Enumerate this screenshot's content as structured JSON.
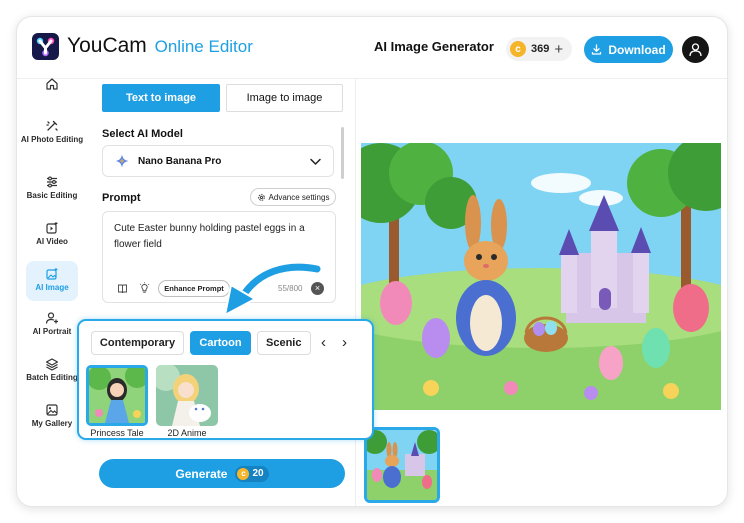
{
  "header": {
    "brand_name": "YouCam",
    "brand_suffix": "Online Editor",
    "page_title": "AI Image Generator",
    "coin_balance": "369",
    "add_symbol": "+",
    "download_label": "Download"
  },
  "sidebar": {
    "items": [
      {
        "label": "",
        "icon": "home-icon"
      },
      {
        "label": "AI Photo Editing",
        "icon": "magic-wand-icon"
      },
      {
        "label": "Basic Editing",
        "icon": "sliders-icon"
      },
      {
        "label": "AI Video",
        "icon": "video-plus-icon"
      },
      {
        "label": "AI Image",
        "icon": "image-plus-icon"
      },
      {
        "label": "AI Portrait",
        "icon": "user-plus-icon"
      },
      {
        "label": "Batch Editing",
        "icon": "layers-icon"
      },
      {
        "label": "My Gallery",
        "icon": "gallery-icon"
      }
    ],
    "active": "AI Image"
  },
  "panel": {
    "tabs": [
      {
        "label": "Text to image",
        "active": true
      },
      {
        "label": "Image to image",
        "active": false
      }
    ],
    "model_section_label": "Select AI Model",
    "model_name": "Nano Banana Pro",
    "prompt_section_label": "Prompt",
    "advance_settings_label": "Advance settings",
    "prompt_text": "Cute Easter bunny holding pastel eggs in a flower field",
    "enhance_label": "Enhance Prompt",
    "char_count": "55/800",
    "clear_symbol": "×",
    "generate_label": "Generate",
    "generate_cost": "20"
  },
  "style_popup": {
    "categories": [
      {
        "label": "Contemporary",
        "active": false
      },
      {
        "label": "Cartoon",
        "active": true
      },
      {
        "label": "Scenic",
        "active": false
      }
    ],
    "prev_symbol": "‹",
    "next_symbol": "›",
    "styles": [
      {
        "label": "Princess Tale",
        "selected": true
      },
      {
        "label": "2D Anime",
        "selected": false
      }
    ]
  },
  "coin_glyph": "c",
  "colors": {
    "accent": "#1e9fe3",
    "coin": "#f5b52a",
    "active_nav_bg": "#e3f2fc"
  }
}
